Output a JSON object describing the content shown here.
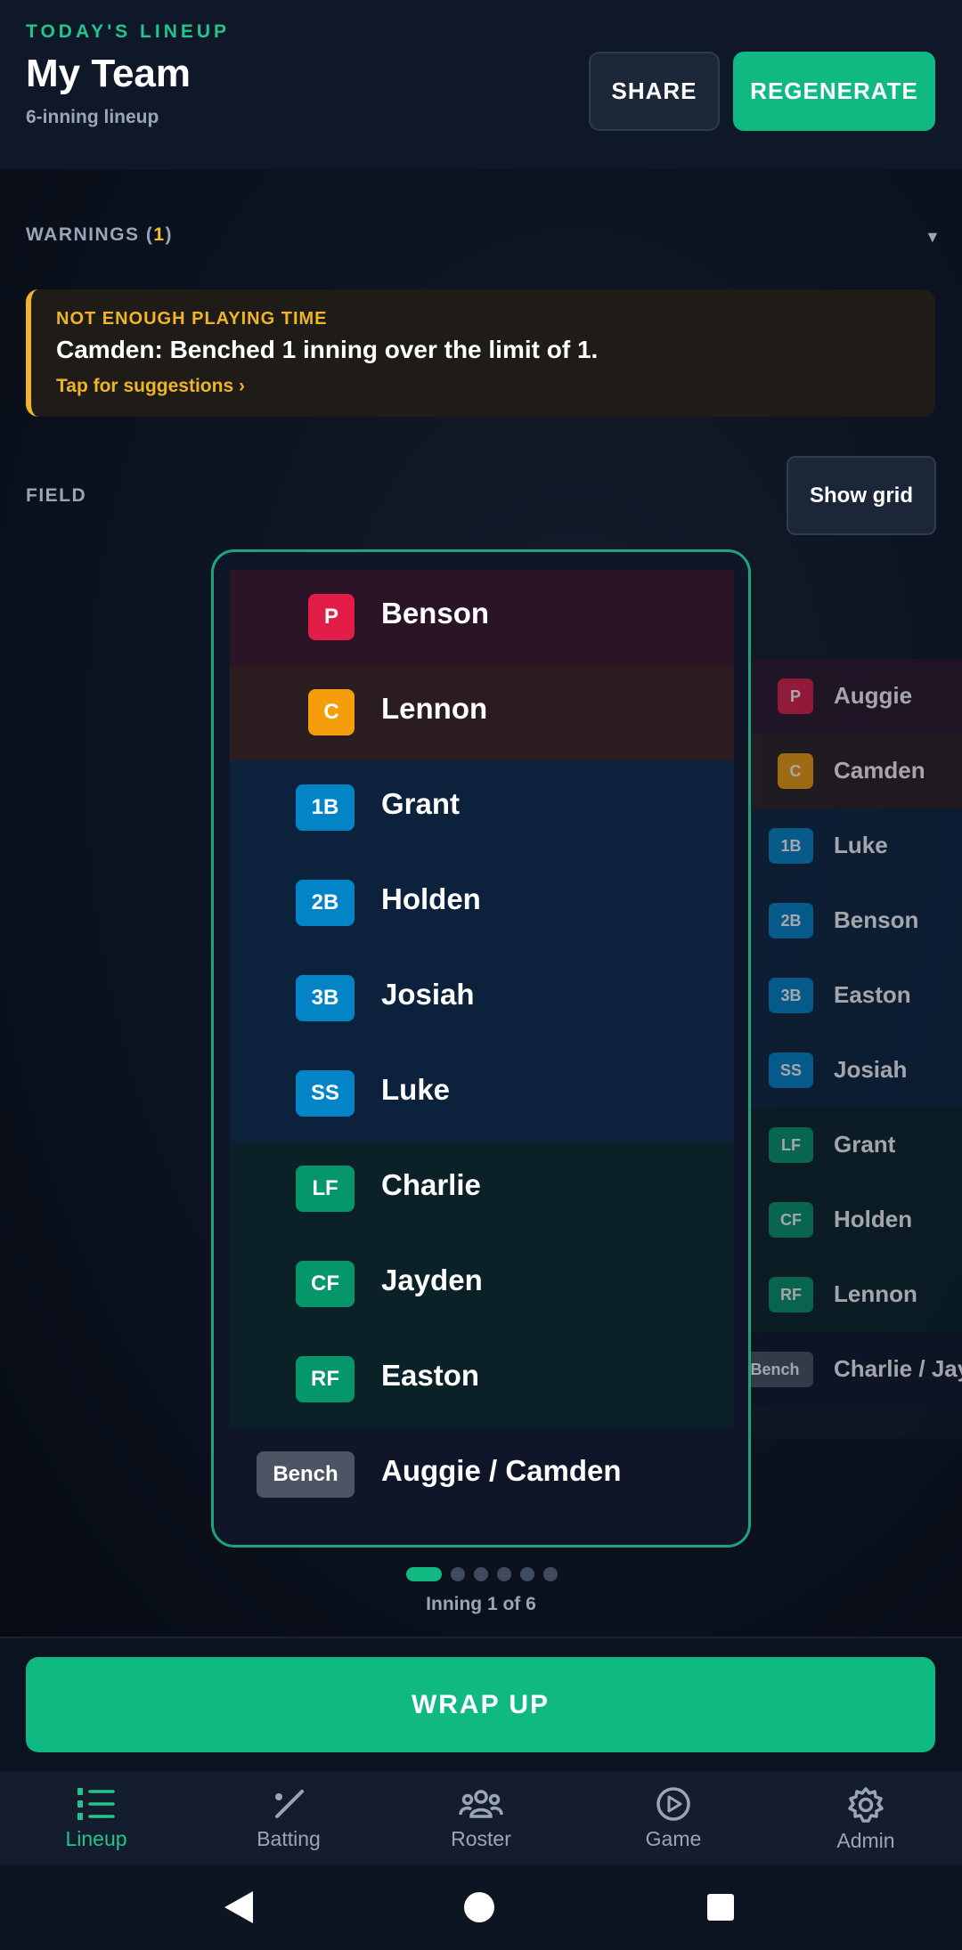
{
  "header": {
    "eyebrow": "TODAY'S LINEUP",
    "title": "My Team",
    "subtitle": "6-inning lineup",
    "share_label": "SHARE",
    "regenerate_label": "REGENERATE"
  },
  "warnings": {
    "heading": "WARNINGS",
    "count": "1",
    "card": {
      "title": "NOT ENOUGH PLAYING TIME",
      "message": "Camden: Benched 1 inning over the limit of 1.",
      "link": "Tap for suggestions ›"
    }
  },
  "field": {
    "label": "FIELD",
    "show_grid_label": "Show grid"
  },
  "innings": [
    {
      "rows": [
        {
          "pos": "P",
          "name": "Benson"
        },
        {
          "pos": "C",
          "name": "Lennon"
        },
        {
          "pos": "1B",
          "name": "Grant"
        },
        {
          "pos": "2B",
          "name": "Holden"
        },
        {
          "pos": "3B",
          "name": "Josiah"
        },
        {
          "pos": "SS",
          "name": "Luke"
        },
        {
          "pos": "LF",
          "name": "Charlie"
        },
        {
          "pos": "CF",
          "name": "Jayden"
        },
        {
          "pos": "RF",
          "name": "Easton"
        },
        {
          "pos": "Bench",
          "name": "Auggie / Camden"
        }
      ]
    },
    {
      "rows": [
        {
          "pos": "P",
          "name": "Auggie"
        },
        {
          "pos": "C",
          "name": "Camden"
        },
        {
          "pos": "1B",
          "name": "Luke"
        },
        {
          "pos": "2B",
          "name": "Benson"
        },
        {
          "pos": "3B",
          "name": "Easton"
        },
        {
          "pos": "SS",
          "name": "Josiah"
        },
        {
          "pos": "LF",
          "name": "Grant"
        },
        {
          "pos": "CF",
          "name": "Holden"
        },
        {
          "pos": "RF",
          "name": "Lennon"
        },
        {
          "pos": "Bench",
          "name": "Charlie / Jayden"
        }
      ]
    }
  ],
  "pager": {
    "label": "Inning 1 of 6",
    "current": 1,
    "total": 6
  },
  "wrap_up_label": "WRAP UP",
  "tabs": [
    {
      "label": "Lineup",
      "icon": "list-numbered-icon",
      "active": true
    },
    {
      "label": "Batting",
      "icon": "baseball-bat-icon",
      "active": false
    },
    {
      "label": "Roster",
      "icon": "group-icon",
      "active": false
    },
    {
      "label": "Game",
      "icon": "play-circle-icon",
      "active": false
    },
    {
      "label": "Admin",
      "icon": "gear-icon",
      "active": false
    }
  ],
  "colors": {
    "accent": "#10b981",
    "warning": "#f0b429",
    "pitcher": "#e11d48",
    "catcher": "#f59e0b",
    "infield": "#0284c7",
    "outfield": "#059669",
    "bench": "#4b5563"
  }
}
